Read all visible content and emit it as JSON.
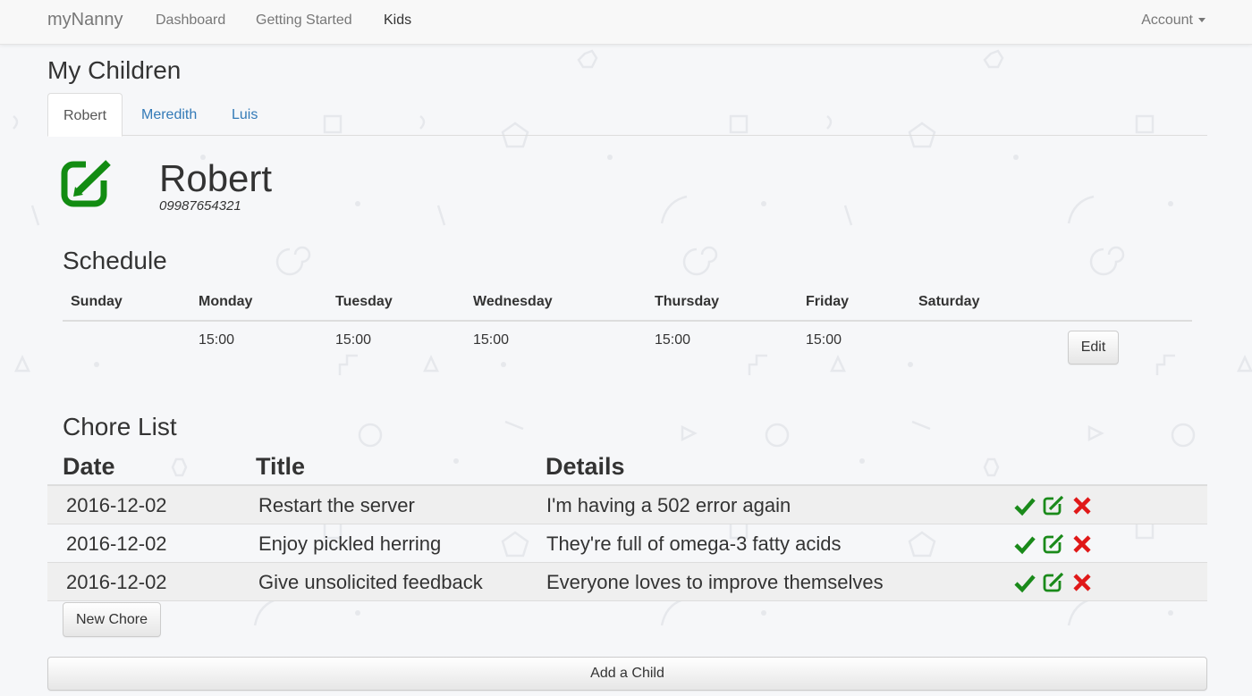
{
  "navbar": {
    "brand": "myNanny",
    "links": [
      "Dashboard",
      "Getting Started",
      "Kids"
    ],
    "active_link": "Kids",
    "account": "Account"
  },
  "page": {
    "title": "My Children"
  },
  "tabs": [
    {
      "label": "Robert",
      "active": true
    },
    {
      "label": "Meredith",
      "active": false
    },
    {
      "label": "Luis",
      "active": false
    }
  ],
  "child": {
    "name": "Robert",
    "phone": "09987654321",
    "icon": "edit-square-icon"
  },
  "schedule": {
    "title": "Schedule",
    "days": [
      "Sunday",
      "Monday",
      "Tuesday",
      "Wednesday",
      "Thursday",
      "Friday",
      "Saturday"
    ],
    "times": [
      "",
      "15:00",
      "15:00",
      "15:00",
      "15:00",
      "15:00",
      ""
    ],
    "edit_label": "Edit"
  },
  "chores": {
    "title": "Chore List",
    "headers": [
      "Date",
      "Title",
      "Details"
    ],
    "rows": [
      {
        "date": "2016-12-02",
        "title": "Restart the server",
        "details": "I'm having a 502 error again"
      },
      {
        "date": "2016-12-02",
        "title": "Enjoy pickled herring",
        "details": "They're full of omega-3 fatty acids"
      },
      {
        "date": "2016-12-02",
        "title": "Give unsolicited feedback",
        "details": "Everyone loves to improve themselves"
      }
    ],
    "actions": [
      "check-icon",
      "edit-icon",
      "delete-icon"
    ],
    "new_label": "New Chore"
  },
  "add_child_label": "Add a Child",
  "colors": {
    "accent": "#337ab7",
    "success": "#1a8a1a",
    "danger": "#e01818",
    "icon_green": "#128c12"
  }
}
